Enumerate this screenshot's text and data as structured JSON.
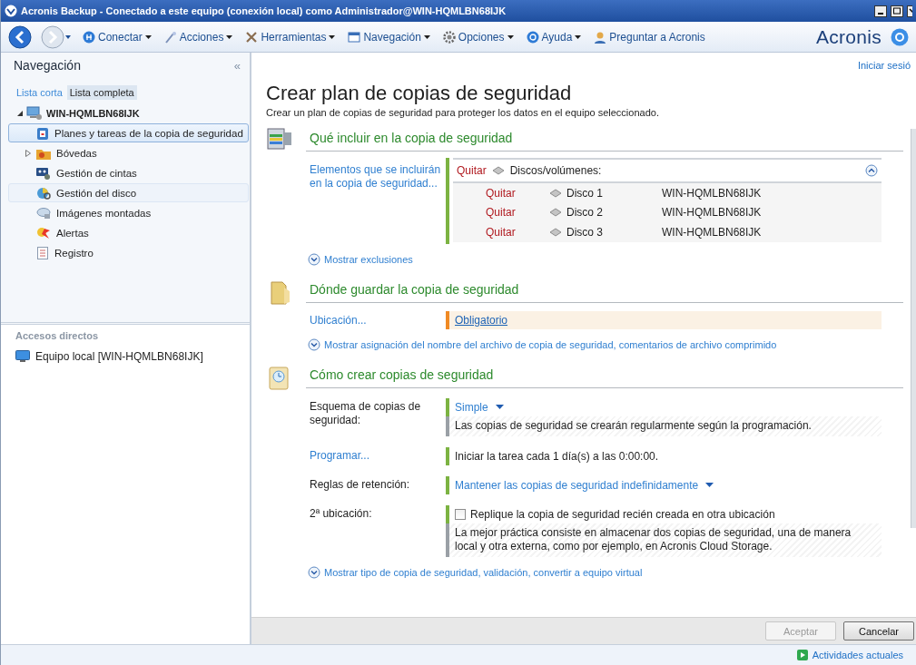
{
  "window": {
    "title": "Acronis Backup - Conectado a este equipo (conexión local) como Administrador@WIN-HQMLBN68IJK"
  },
  "toolbar": {
    "items": [
      {
        "label": "Conectar",
        "has_menu": true
      },
      {
        "label": "Acciones",
        "has_menu": true
      },
      {
        "label": "Herramientas",
        "has_menu": true
      },
      {
        "label": "Navegación",
        "has_menu": true
      },
      {
        "label": "Opciones",
        "has_menu": true
      },
      {
        "label": "Ayuda",
        "has_menu": true
      },
      {
        "label": "Preguntar a Acronis",
        "has_menu": false
      }
    ],
    "brand": "Acronis"
  },
  "navigation": {
    "title": "Navegación",
    "collapse": "«",
    "tabs": [
      {
        "label": "Lista corta",
        "selected": false
      },
      {
        "label": "Lista completa",
        "selected": true
      }
    ],
    "tree": {
      "label": "WIN-HQMLBN68IJK",
      "expanded": true,
      "children": [
        {
          "label": "Planes y tareas de la copia de seguridad",
          "selected": true,
          "hovered": false,
          "expandable": false
        },
        {
          "label": "Bóvedas",
          "selected": false,
          "hovered": false,
          "expandable": true
        },
        {
          "label": "Gestión de cintas",
          "selected": false,
          "hovered": false,
          "expandable": false
        },
        {
          "label": "Gestión del disco",
          "selected": false,
          "hovered": true,
          "expandable": false
        },
        {
          "label": "Imágenes montadas",
          "selected": false,
          "hovered": false,
          "expandable": false
        },
        {
          "label": "Alertas",
          "selected": false,
          "hovered": false,
          "expandable": false
        },
        {
          "label": "Registro",
          "selected": false,
          "hovered": false,
          "expandable": false
        }
      ]
    },
    "shortcuts": {
      "title": "Accesos directos",
      "items": [
        {
          "label": "Equipo local [WIN-HQMLBN68IJK]"
        }
      ]
    }
  },
  "main": {
    "sign_in": "Iniciar sesió",
    "title": "Crear plan de copias de seguridad",
    "subtitle": "Crear un plan de copias de seguridad para proteger los datos en el equipo seleccionado.",
    "what": {
      "title": "Qué incluir en la copia de seguridad",
      "label": "Elementos que se incluirán en la copia de seguridad...",
      "remove": "Quitar",
      "group": "Discos/volúmenes:",
      "expanded": true,
      "items": [
        {
          "remove": "Quitar",
          "name": "Disco 1",
          "machine": "WIN-HQMLBN68IJK"
        },
        {
          "remove": "Quitar",
          "name": "Disco 2",
          "machine": "WIN-HQMLBN68IJK"
        },
        {
          "remove": "Quitar",
          "name": "Disco 3",
          "machine": "WIN-HQMLBN68IJK"
        }
      ],
      "more": "Mostrar exclusiones"
    },
    "where": {
      "title": "Dónde guardar la copia de seguridad",
      "label": "Ubicación...",
      "value": "Obligatorio",
      "required": true,
      "more": "Mostrar asignación del nombre del archivo de copia de seguridad, comentarios de archivo comprimido"
    },
    "how": {
      "title": "Cómo crear copias de seguridad",
      "rows": [
        {
          "kind": "dropdown",
          "label": "Esquema de copias de seguridad:",
          "label_link": false,
          "value": "Simple",
          "description": "Las copias de seguridad se crearán regularmente según la programación."
        },
        {
          "kind": "text",
          "label": "Programar...",
          "label_link": true,
          "value": "Iniciar la tarea cada 1 día(s) a las 0:00:00."
        },
        {
          "kind": "dropdown",
          "label": "Reglas de retención:",
          "label_link": false,
          "value": "Mantener las copias de seguridad indefinidamente"
        },
        {
          "kind": "checkbox",
          "label": "2ª ubicación:",
          "label_link": false,
          "value": "Replique la copia de seguridad recién creada en otra ubicación",
          "checked": false,
          "description": "La mejor práctica consiste en almacenar dos copias de seguridad, una de manera local y otra externa, como por ejemplo, en Acronis Cloud Storage."
        }
      ],
      "more": "Mostrar tipo de copia de seguridad, validación, convertir a equipo virtual"
    },
    "buttons": [
      {
        "label": "Aceptar",
        "disabled": true
      },
      {
        "label": "Cancelar",
        "disabled": false
      }
    ]
  },
  "status_bar": {
    "label": "Actividades actuales"
  }
}
